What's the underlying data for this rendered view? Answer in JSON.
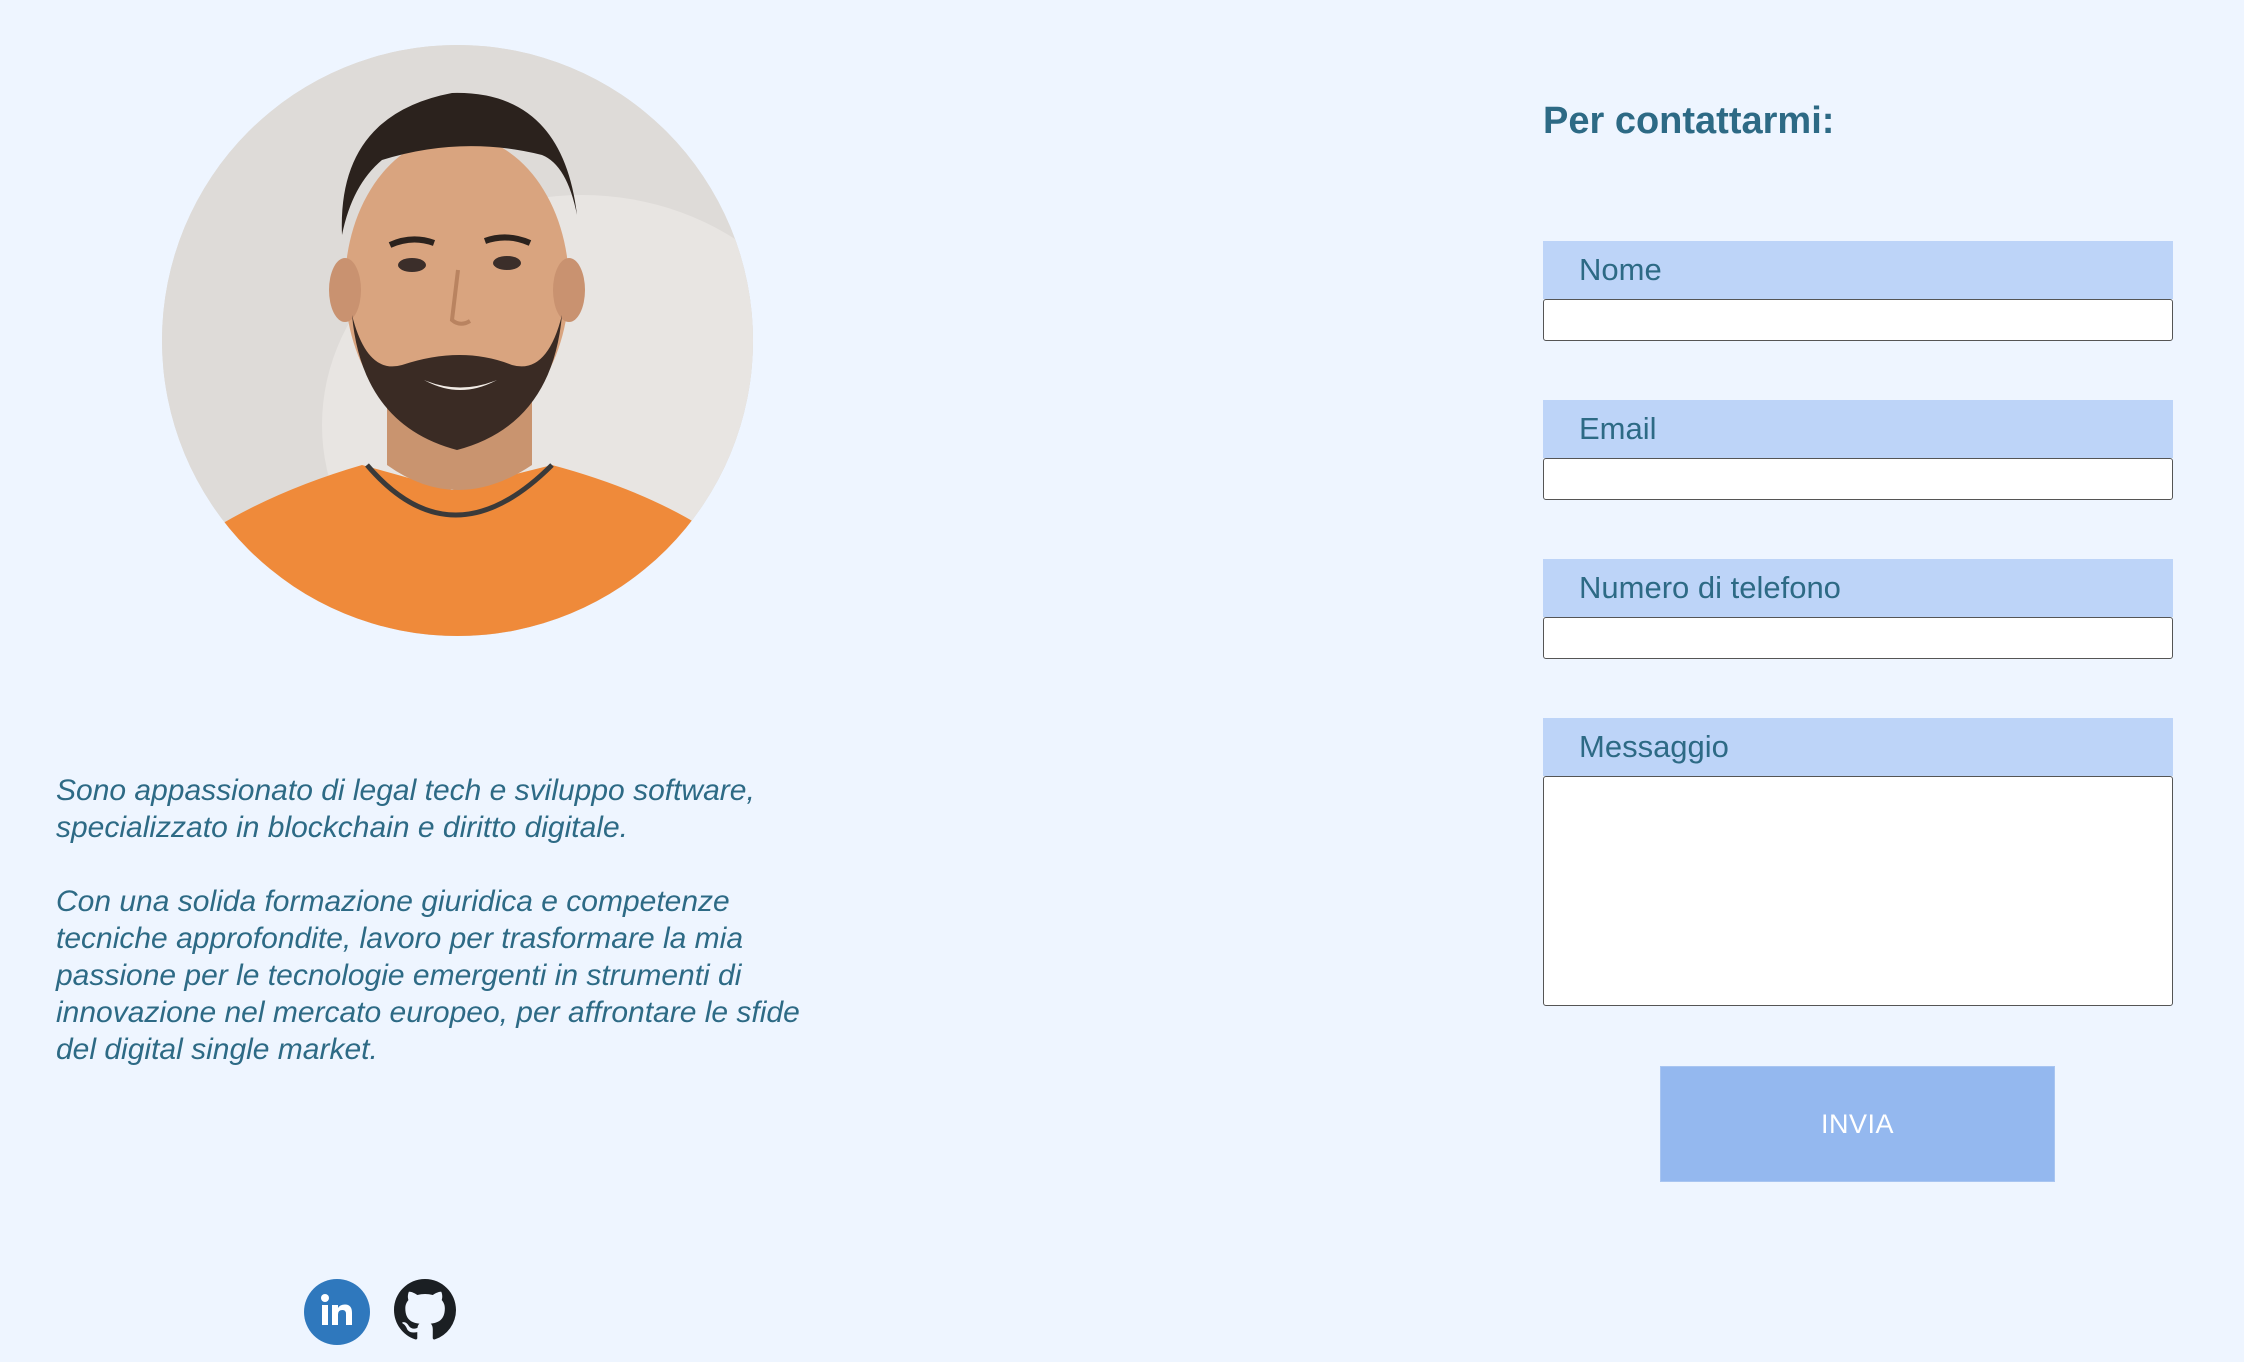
{
  "profile": {
    "photo_alt": "profile-photo"
  },
  "bio": {
    "paragraph_1": "Sono appassionato di legal tech e sviluppo software,\nspecializzato in blockchain e diritto digitale.",
    "paragraph_2": "Con una solida formazione giuridica e competenze\ntecniche approfondite, lavoro per trasformare la mia\npassione per le tecnologie emergenti in strumenti di\ninnovazione nel mercato europeo, per affrontare le sfide\ndel digital single market."
  },
  "socials": [
    {
      "name": "linkedin",
      "icon": "linkedin-icon"
    },
    {
      "name": "github",
      "icon": "github-icon"
    }
  ],
  "contact_form": {
    "title": "Per contattarmi:",
    "fields": {
      "name": {
        "label": "Nome",
        "value": ""
      },
      "email": {
        "label": "Email",
        "value": ""
      },
      "phone": {
        "label": "Numero di telefono",
        "value": ""
      },
      "message": {
        "label": "Messaggio",
        "value": ""
      }
    },
    "submit_label": "INVIA"
  },
  "colors": {
    "background": "#eef5ff",
    "text": "#2d6a85",
    "label_bg": "#bdd4f8",
    "button_bg": "#94b8ef",
    "linkedin": "#2f78bd"
  }
}
